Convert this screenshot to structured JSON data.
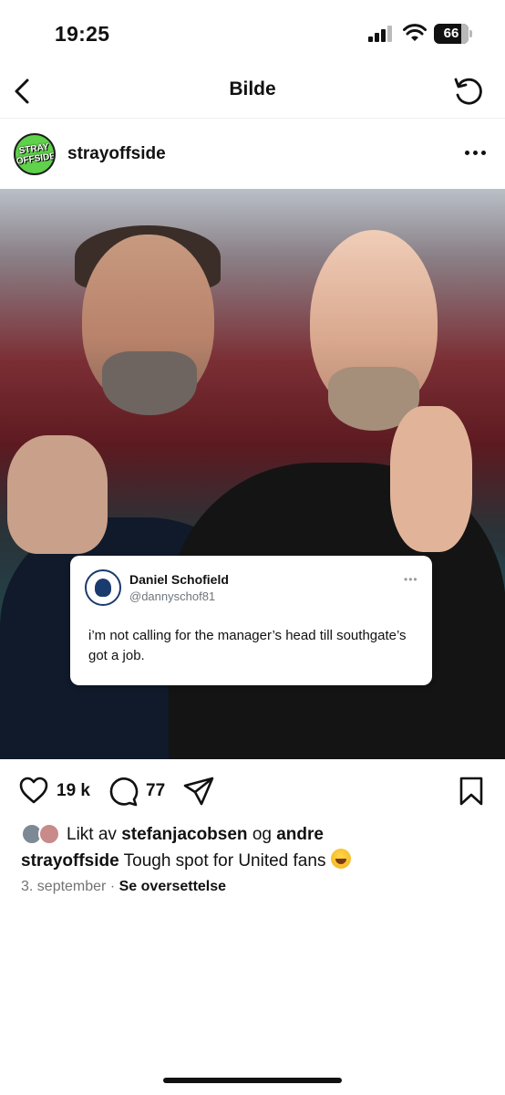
{
  "status_bar": {
    "time": "19:25",
    "battery": "66"
  },
  "nav": {
    "title": "Bilde"
  },
  "post": {
    "username": "strayoffside",
    "avatar_text": "STRAY OFFSIDE",
    "tweet": {
      "name": "Daniel Schofield",
      "handle": "@dannyschof81",
      "text": "i’m not calling for the manager’s head till southgate’s got a job."
    }
  },
  "actions": {
    "likes": "19 k",
    "comments": "77"
  },
  "liked_by": {
    "prefix": "Likt av",
    "user1": "stefanjacobsen",
    "joiner": "og",
    "user2": "andre"
  },
  "caption": {
    "user": "strayoffside",
    "text": "Tough spot for United fans"
  },
  "meta": {
    "date": "3. september",
    "separator": "·",
    "translate": "Se oversettelse"
  },
  "colors": {
    "avatar_green": "#5fd14a",
    "photo_teal": "#137a86"
  }
}
